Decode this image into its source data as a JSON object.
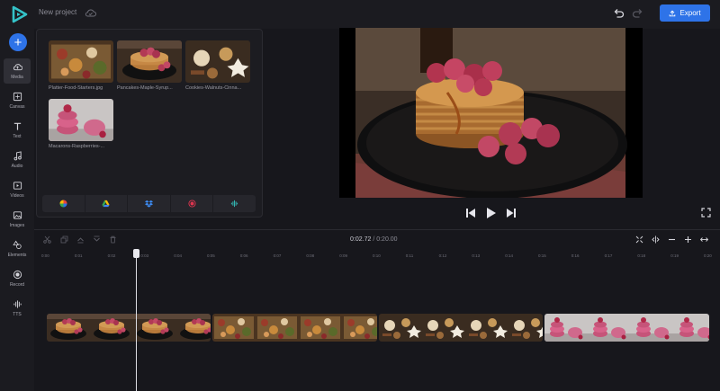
{
  "app": {
    "project_title": "New project",
    "export_label": "Export",
    "colors": {
      "accent": "#2e73e8",
      "background": "#17171c",
      "panel": "#1c1c21"
    }
  },
  "sidebar": {
    "items": [
      {
        "label": "Media",
        "icon": "cloud-upload-icon",
        "active": true
      },
      {
        "label": "Canvas",
        "icon": "canvas-icon"
      },
      {
        "label": "Text",
        "icon": "text-icon"
      },
      {
        "label": "Audio",
        "icon": "music-note-icon"
      },
      {
        "label": "Videos",
        "icon": "video-icon"
      },
      {
        "label": "Images",
        "icon": "image-icon"
      },
      {
        "label": "Elements",
        "icon": "shapes-icon"
      },
      {
        "label": "Record",
        "icon": "record-icon"
      },
      {
        "label": "TTS",
        "icon": "waveform-icon"
      }
    ]
  },
  "media": {
    "files": [
      {
        "name": "Platter-Food-Starters.jpg",
        "icon": "platter-photo"
      },
      {
        "name": "Pancakes-Maple-Syrup...",
        "icon": "pancakes-photo"
      },
      {
        "name": "Cookies-Walnuts-Cinna...",
        "icon": "cookies-photo"
      },
      {
        "name": "Macarons-Raspberries-...",
        "icon": "macarons-photo"
      }
    ],
    "sources": [
      {
        "icon": "pinwheel-icon"
      },
      {
        "icon": "google-drive-icon"
      },
      {
        "icon": "dropbox-icon"
      },
      {
        "icon": "record-icon"
      },
      {
        "icon": "audio-waveform-icon"
      }
    ]
  },
  "timeline": {
    "current_time": "0:02.72",
    "separator": "/",
    "total_time": "0:20.00",
    "ticks": [
      "0:00",
      "0:01",
      "0:02",
      "0:03",
      "0:04",
      "0:05",
      "0:06",
      "0:07",
      "0:08",
      "0:09",
      "0:10",
      "0:11",
      "0:12",
      "0:13",
      "0:14",
      "0:15",
      "0:16",
      "0:17",
      "0:18",
      "0:19",
      "0:20"
    ],
    "clips": [
      {
        "name": "Pancakes-Maple-Syrup",
        "start": 0,
        "end": 5
      },
      {
        "name": "Platter-Food-Starters",
        "start": 5,
        "end": 10
      },
      {
        "name": "Cookies-Walnuts-Cinnamon",
        "start": 10,
        "end": 15
      },
      {
        "name": "Macarons-Raspberries",
        "start": 15,
        "end": 20
      }
    ]
  }
}
